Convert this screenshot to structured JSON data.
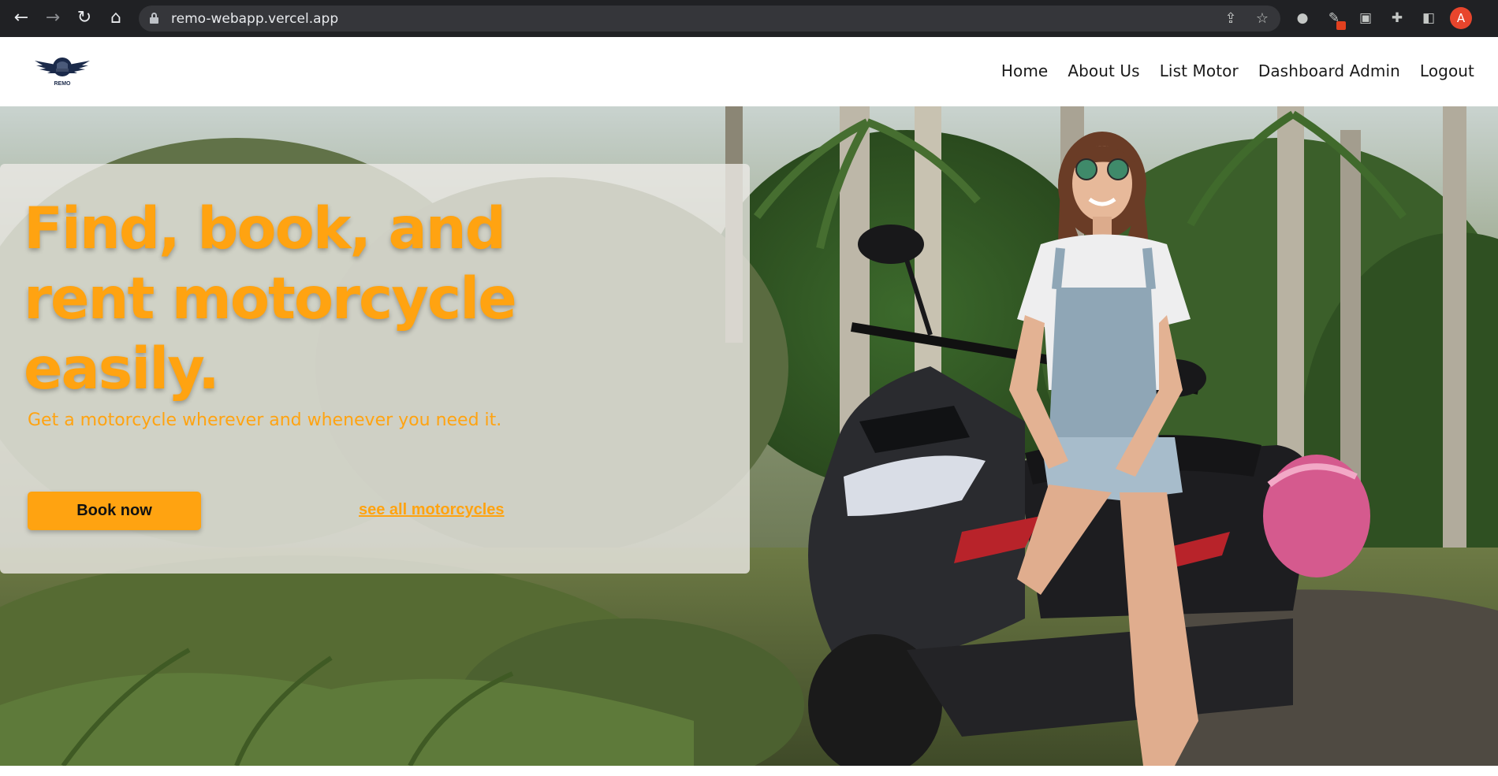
{
  "browser": {
    "url": "remo-webapp.vercel.app",
    "profile_initial": "A",
    "icons": [
      "back-icon",
      "forward-icon",
      "reload-icon",
      "home-icon",
      "lock-icon",
      "share-icon",
      "bookmark-star-icon",
      "extension-icon",
      "extensions-puzzle-icon",
      "side-panel-icon",
      "profile-avatar"
    ]
  },
  "site": {
    "logo_text": "REMO",
    "nav": {
      "home": "Home",
      "about": "About Us",
      "list_motor": "List Motor",
      "dashboard": "Dashboard Admin",
      "logout": "Logout"
    }
  },
  "hero": {
    "headline_line1": "Find, book, and",
    "headline_line2": "rent motorcycle",
    "headline_line3": "easily.",
    "subheadline": "Get a motorcycle wherever and whenever you need it.",
    "book_button": "Book now",
    "see_all_link": "see all motorcycles"
  },
  "colors": {
    "accent": "#ffa311",
    "chrome_bg": "#202124",
    "omnibox_bg": "#35363a",
    "header_bg": "#ffffff",
    "nav_text": "#1a1a1a"
  }
}
